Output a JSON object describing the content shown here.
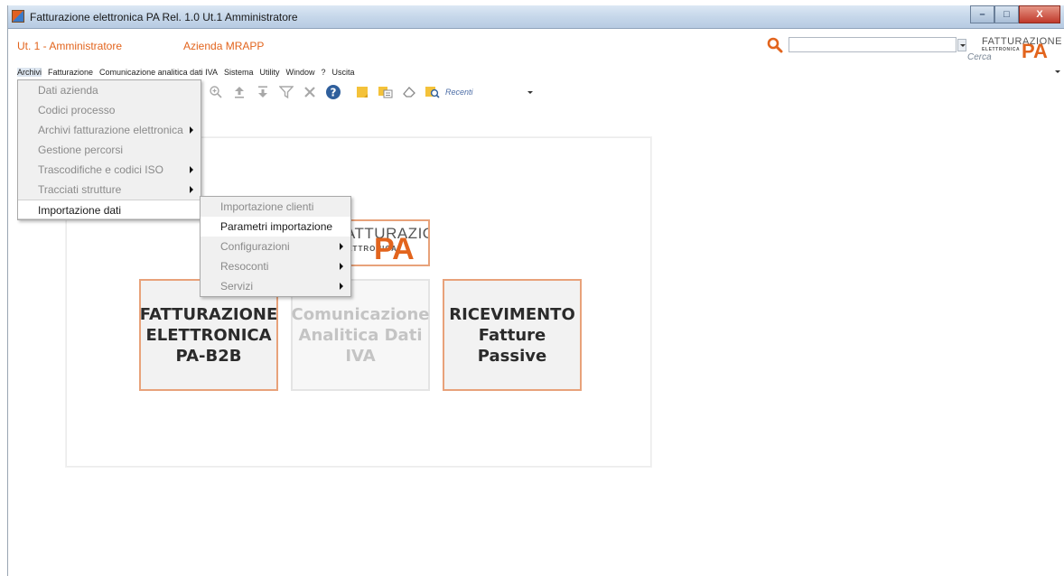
{
  "window": {
    "title": "Fatturazione elettronica PA Rel. 1.0 Ut.1 Amministratore",
    "controls": {
      "minimize": "–",
      "maximize": "□",
      "close": "X"
    }
  },
  "header": {
    "user": "Ut. 1 - Amministratore",
    "company": "Azienda MRAPP",
    "search_value": "",
    "search_caption": "Cerca",
    "logo_top": "FATTURAZIONE",
    "logo_sub": "ELETTRONICA",
    "logo_pa": "PA"
  },
  "menubar": {
    "items": [
      {
        "label": "Archivi",
        "active": true
      },
      {
        "label": "Fatturazione"
      },
      {
        "label": "Comunicazione analitica dati IVA"
      },
      {
        "label": "Sistema"
      },
      {
        "label": "Utility"
      },
      {
        "label": "Window"
      },
      {
        "label": "?"
      },
      {
        "label": "Uscita"
      }
    ]
  },
  "toolbar": {
    "recenti_label": "Recenti"
  },
  "archivi_menu": {
    "items": [
      {
        "label": "Dati azienda"
      },
      {
        "label": "Codici processo"
      },
      {
        "label": "Archivi fatturazione elettronica",
        "submenu": true
      },
      {
        "label": "Gestione percorsi"
      },
      {
        "label": "Trascodifiche e codici ISO",
        "submenu": true
      },
      {
        "label": "Tracciati strutture",
        "submenu": true
      },
      {
        "label": "Importazione dati",
        "submenu": true,
        "highlighted": true
      }
    ]
  },
  "importazione_menu": {
    "items": [
      {
        "label": "Importazione clienti"
      },
      {
        "label": "Parametri importazione",
        "hover": true
      },
      {
        "label": "Configurazioni",
        "submenu": true
      },
      {
        "label": "Resoconti",
        "submenu": true
      },
      {
        "label": "Servizi",
        "submenu": true
      }
    ]
  },
  "center_logo": {
    "top": "FATTURAZIONE",
    "sub": "ELETTRONICA",
    "pa": "PA"
  },
  "tiles": {
    "fe": "FATTURAZIONE ELETTRONICA PA-B2B",
    "ca": "Comunicazione Analitica Dati IVA",
    "rf": "RICEVIMENTO Fatture Passive"
  },
  "colors": {
    "accent": "#e2641d",
    "tile_border": "#e8a27a",
    "disabled_text": "#c4c4c4"
  }
}
